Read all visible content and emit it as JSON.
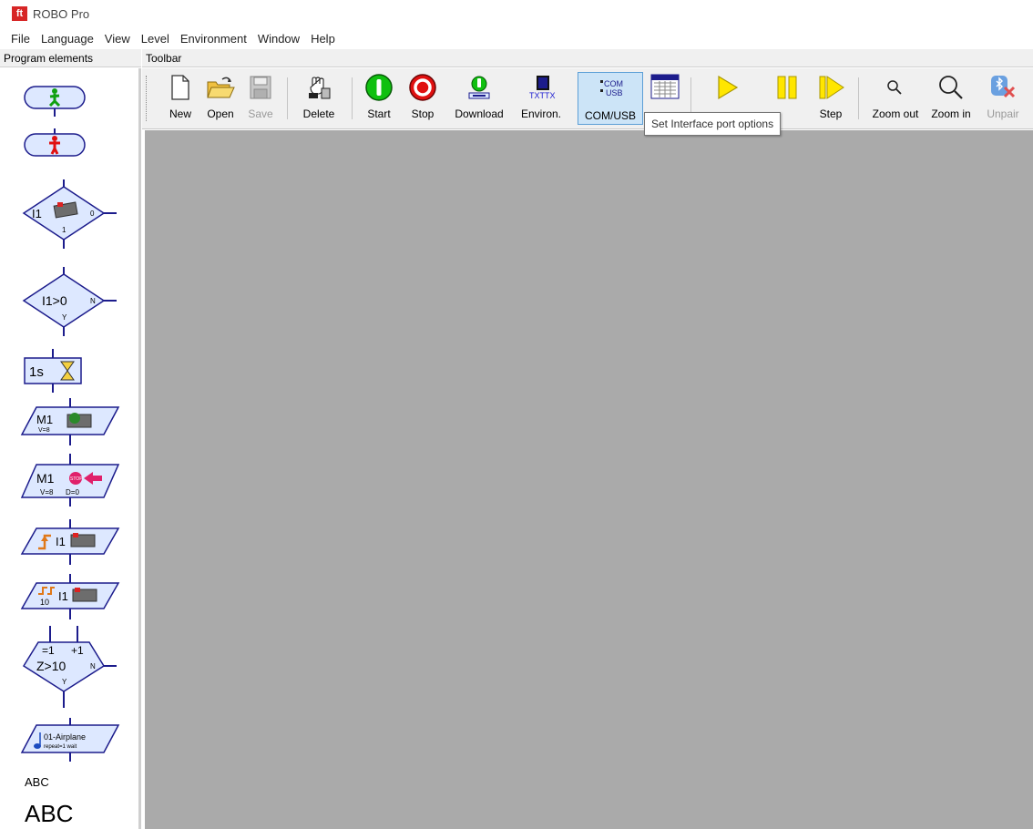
{
  "window": {
    "title": "ROBO Pro",
    "logo_text": "ft"
  },
  "menu": [
    "File",
    "Language",
    "View",
    "Level",
    "Environment",
    "Window",
    "Help"
  ],
  "left_panel": {
    "header": "Program elements",
    "elements": {
      "branch_input": {
        "port": "I1",
        "right": "0",
        "bottom": "1"
      },
      "compare": {
        "expr": "I1>0",
        "right": "N",
        "bottom": "Y"
      },
      "wait": {
        "text": "1s"
      },
      "motor": {
        "port": "M1",
        "sub": "V=8"
      },
      "motor_stop": {
        "port": "M1",
        "sub1": "V=8",
        "sub2": "D=0",
        "stop_text": "STOP"
      },
      "edge": {
        "port": "I1"
      },
      "pulse": {
        "port": "I1",
        "count": "10"
      },
      "counter": {
        "top1": "=1",
        "top2": "+1",
        "expr": "Z>10",
        "right": "N",
        "bottom": "Y"
      },
      "sound": {
        "name": "01-Airplane",
        "sub": "repeat=1 wait"
      },
      "text_small": "ABC",
      "text_large": "ABC"
    }
  },
  "toolbar": {
    "header": "Toolbar",
    "buttons": {
      "new": "New",
      "open": "Open",
      "save": "Save",
      "delete": "Delete",
      "start": "Start",
      "stop": "Stop",
      "download": "Download",
      "environ": "Environ.",
      "comusb": "COM/USB",
      "step": "Step",
      "zoom_out": "Zoom out",
      "zoom_in": "Zoom in",
      "unpair": "Unpair"
    },
    "icon_text": {
      "txt": "TXTTX",
      "com": "COM",
      "usb": "USB"
    }
  },
  "tooltip": "Set Interface port options",
  "colors": {
    "element_border": "#1c1c8c",
    "element_fill": "#dde8ff",
    "workspace": "#aaaaaa",
    "start_green": "#10c010",
    "stop_red": "#e01010",
    "step_yellow": "#ffe600"
  }
}
